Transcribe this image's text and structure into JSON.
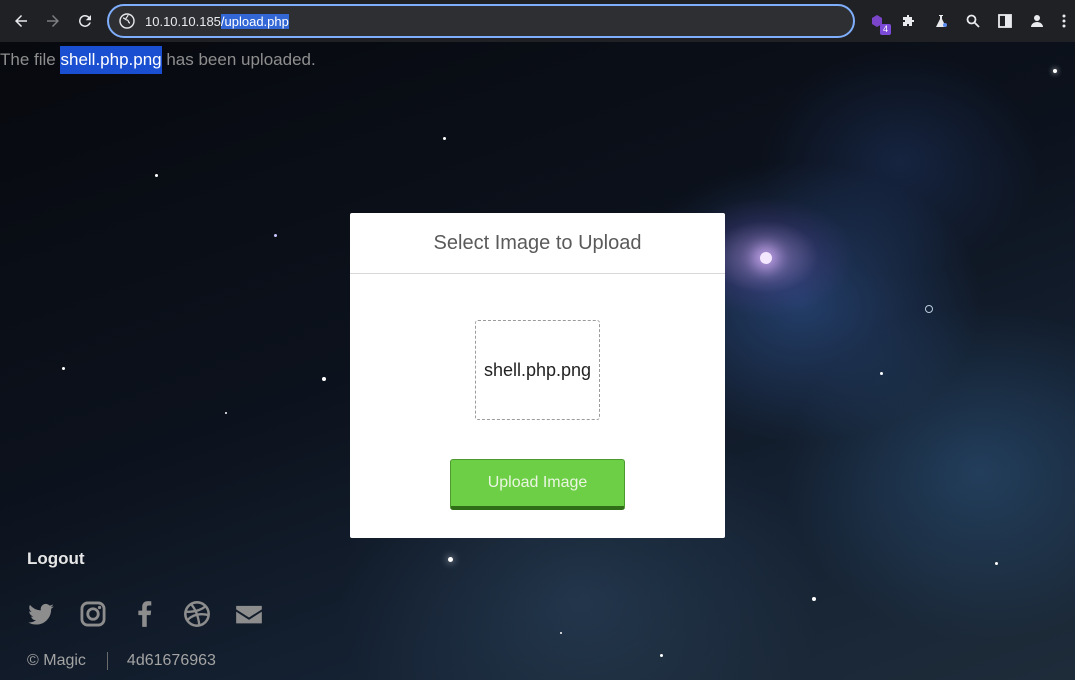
{
  "browser": {
    "url_host": "10.10.10.185",
    "url_path": "/upload.php",
    "extension_badge": "4",
    "icons": [
      "back-icon",
      "forward-icon",
      "reload-icon",
      "site-info-icon",
      "extension-icon",
      "puzzle-icon",
      "labs-icon",
      "search-icon",
      "side-panel-icon",
      "profile-icon",
      "menu-icon"
    ]
  },
  "page": {
    "message_prefix": "The file ",
    "message_filename": "shell.php.png",
    "message_suffix": " has been uploaded.",
    "card": {
      "title": "Select Image to Upload",
      "selected_file": "shell.php.png",
      "upload_button": "Upload Image"
    },
    "logout": "Logout",
    "social_icons": [
      "twitter-icon",
      "instagram-icon",
      "facebook-icon",
      "dribbble-icon",
      "envelope-icon"
    ],
    "footer": {
      "copyright": "© Magic",
      "hash": "4d61676963"
    }
  },
  "colors": {
    "browser_bg": "#202124",
    "omnibox_border": "#7faefc",
    "selection": "#3367d6",
    "upload_button": "#6dcf45"
  }
}
